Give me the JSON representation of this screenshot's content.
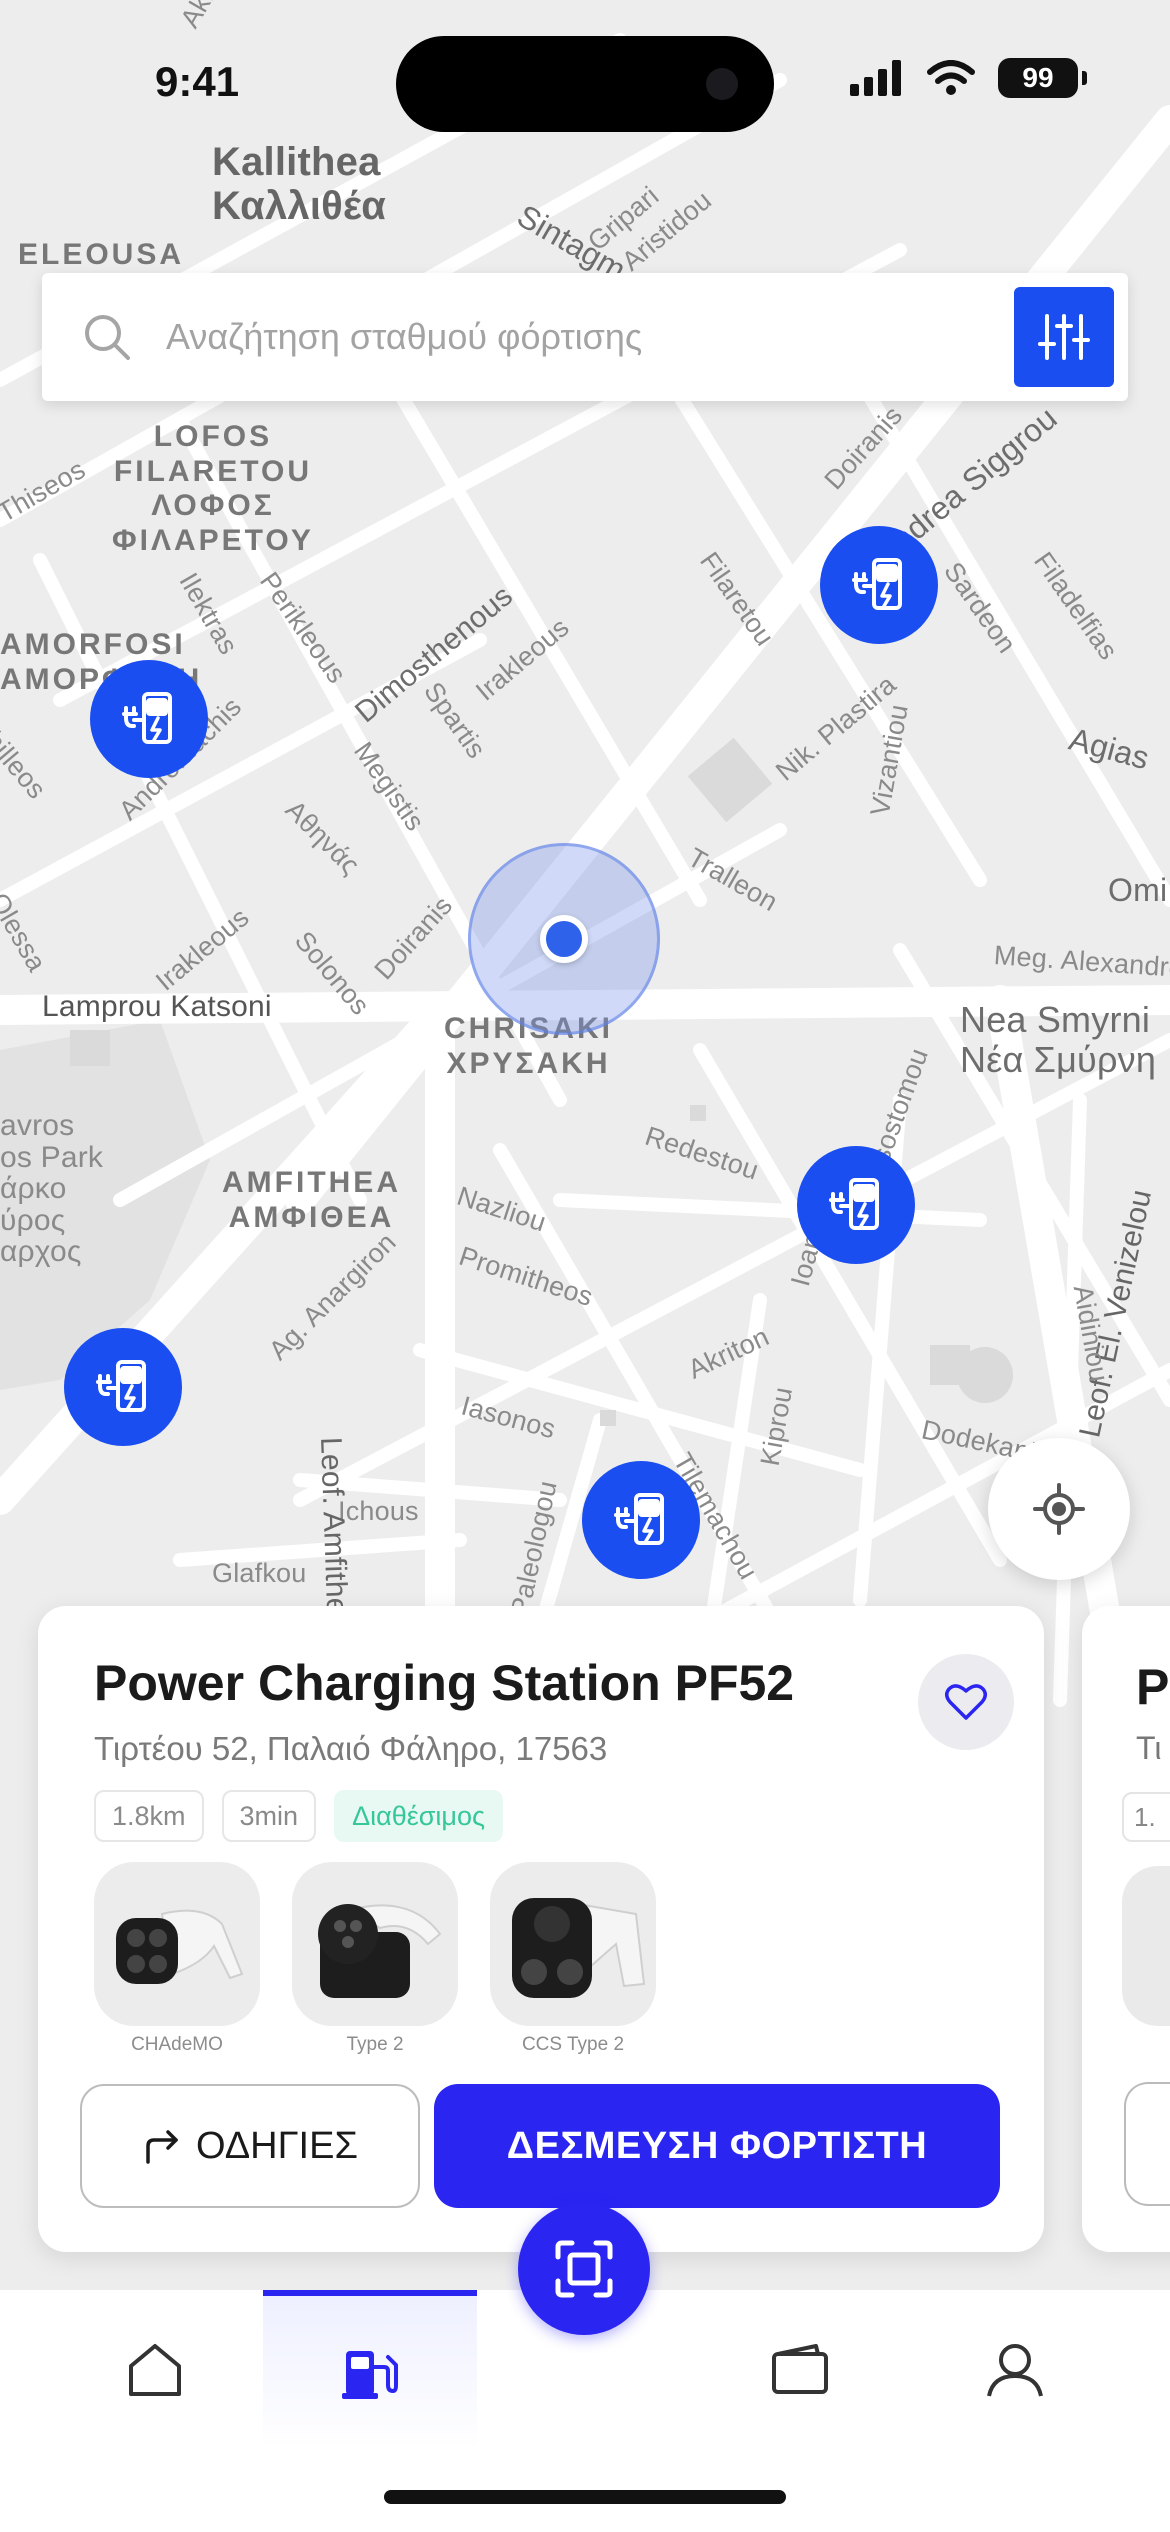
{
  "status_bar": {
    "time": "9:41",
    "battery": "99"
  },
  "search": {
    "placeholder": "Αναζήτηση σταθμού φόρτισης"
  },
  "map": {
    "labels": {
      "kallithea": "Kallithea\nΚαλλιθέα",
      "eleousa": "ELEOUSA",
      "lofos": "LOFOS\nFILARETOU\nΛΟΦΟΣ\nΦΙΛΑΡΕΤΟΥ",
      "amorfosi": "AMORFOSI\nΑΜΟΡΦΩΣΗ",
      "chrisaki": "CHRISAKI\nΧΡΥΣΑΚΗ",
      "amfithea": "AMFITHEA\nΑΜΦΙΘΕΑ",
      "nea_smyrni": "Nea Smyrni\nΝέα Σμύρνη",
      "lamprou": "Lamprou Katsoni",
      "ichous": "Ichous",
      "glafkou": "Glafkou",
      "filaretou": "Filaretou",
      "dimosthenous": "Dimosthenous",
      "irakleous": "Irakleous",
      "spartis": "Spartis",
      "megistis": "Megistis",
      "athinas": "Αθηνάς",
      "solonos": "Solonos",
      "doiranis": "Doiranis",
      "ilektras": "Ilektras",
      "perikleous": "Perikleous",
      "andromachis": "Andromachis",
      "thiseos": "Thiseos",
      "doiranis2": "Doiranis",
      "sigrou": "Andrea Siggrou",
      "sardeon": "Sardeon",
      "filadelfias": "Filadelfias",
      "nik_plastira": "Nik. Plastira",
      "vizantiou": "Vizantiou",
      "agias": "Agias",
      "tralleon": "Tralleon",
      "omi": "Omi",
      "meg_alexandrou": "Meg. Alexandrou",
      "redestou": "Redestou",
      "nazliou": "Nazliou",
      "promitheos": "Promitheos",
      "ag_anargiron": "Ag. Anargiron",
      "leof_amfitheas": "Leof. Amfitheas",
      "iasonos": "Iasonos",
      "akriton": "Akriton",
      "tilemachou": "Tilemachou",
      "kiprou": "Kiprou",
      "dodekanisou": "Dodekani",
      "leof_el_venizelou": "Leof. El. Venizelou",
      "aidiniou": "Aidiniou",
      "paleologou": "Paleologou",
      "sintagmatos": "Sintagm",
      "gripari": "Gripari",
      "aristidou": "Aristidou",
      "chrysostomou": "Chrysostomou",
      "ioanninon": "Ioan",
      "lavros": "avros\nos Park\nάρκο\nύρος\nαρχος",
      "olessa": "Olessa",
      "achilleos": "hilleos",
      "akropoleos": "Akropo"
    }
  },
  "station": {
    "name": "Power Charging Station PF52",
    "address": "Τιρτέου 52, Παλαιό Φάληρο, 17563",
    "distance": "1.8km",
    "duration": "3min",
    "availability": "Διαθέσιμος",
    "connectors": [
      {
        "label": "CHAdeMO"
      },
      {
        "label": "Type 2"
      },
      {
        "label": "CCS Type 2"
      }
    ],
    "directions_label": "ΟΔΗΓΙΕΣ",
    "reserve_label": "ΔΕΣΜΕΥΣΗ ΦΟΡΤΙΣΤΗ"
  },
  "next_station": {
    "title_partial": "P",
    "subtitle_partial": "Τι",
    "chip_partial": "1."
  },
  "colors": {
    "primary": "#2b25f2",
    "pin": "#1a4ef0",
    "available": "#35c79a"
  },
  "tabbar": {
    "tabs": [
      {
        "icon": "home-icon"
      },
      {
        "icon": "fuel-station-icon",
        "active": true
      },
      {
        "icon": "scan-icon"
      },
      {
        "icon": "wallet-icon"
      },
      {
        "icon": "user-icon"
      }
    ]
  }
}
